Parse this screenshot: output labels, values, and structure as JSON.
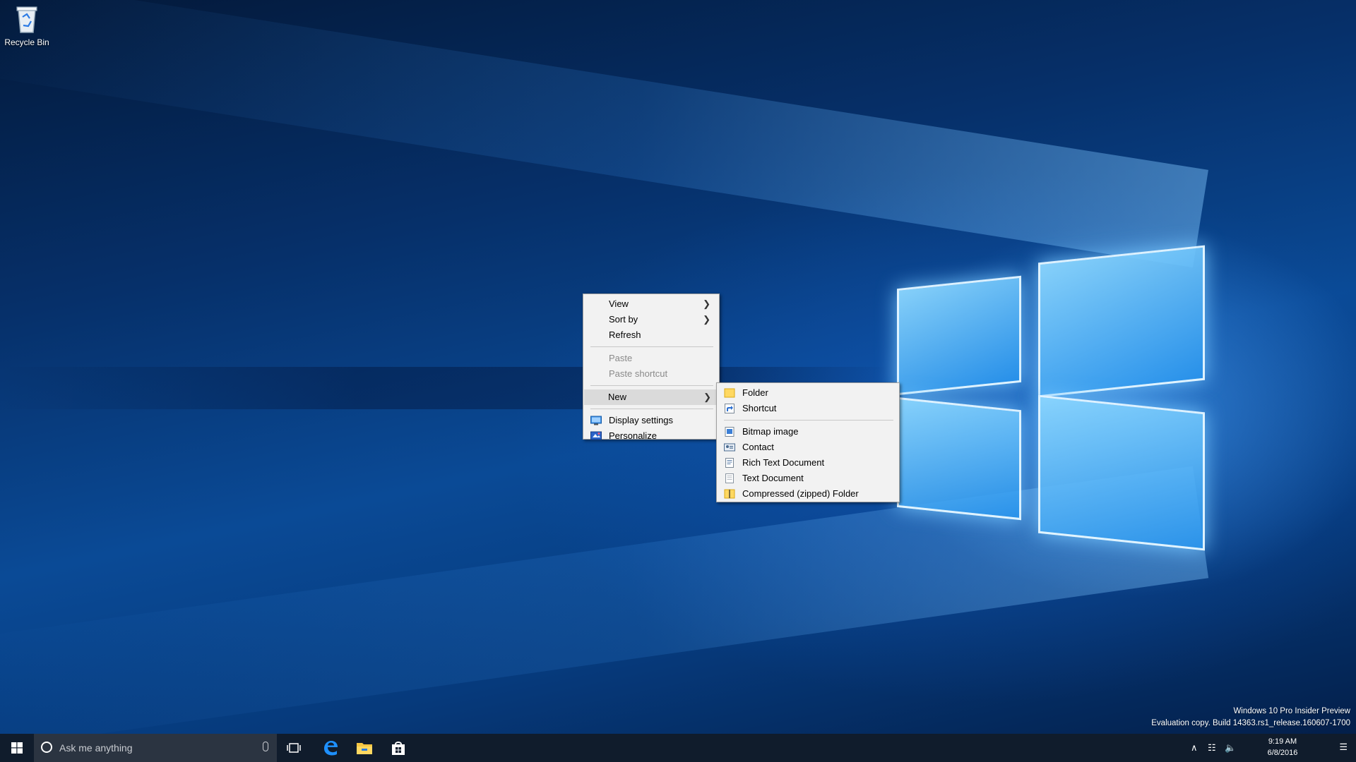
{
  "desktop": {
    "icons": [
      {
        "label": "Recycle Bin",
        "icon": "recycle-bin-icon"
      }
    ]
  },
  "context_menu": {
    "items": [
      {
        "label": "View",
        "has_submenu": true
      },
      {
        "label": "Sort by",
        "has_submenu": true
      },
      {
        "label": "Refresh"
      },
      {
        "label": "Paste",
        "disabled": true
      },
      {
        "label": "Paste shortcut",
        "disabled": true
      },
      {
        "label": "New",
        "has_submenu": true,
        "highlighted": true
      },
      {
        "label": "Display settings",
        "icon": "display-settings-icon"
      },
      {
        "label": "Personalize",
        "icon": "personalize-icon"
      }
    ]
  },
  "new_submenu": {
    "items": [
      {
        "label": "Folder",
        "icon": "folder-icon"
      },
      {
        "label": "Shortcut",
        "icon": "shortcut-icon"
      },
      {
        "label": "Bitmap image",
        "icon": "bitmap-image-icon"
      },
      {
        "label": "Contact",
        "icon": "contact-icon"
      },
      {
        "label": "Rich Text Document",
        "icon": "rich-text-document-icon"
      },
      {
        "label": "Text Document",
        "icon": "text-document-icon"
      },
      {
        "label": "Compressed (zipped) Folder",
        "icon": "zipped-folder-icon"
      }
    ]
  },
  "taskbar": {
    "search_placeholder": "Ask me anything",
    "pinned": [
      "edge-icon",
      "file-explorer-icon",
      "store-icon"
    ],
    "clock_time": "9:19 AM",
    "clock_date": "6/8/2016"
  },
  "watermark": {
    "line1": "Windows 10 Pro Insider Preview",
    "line2": "Evaluation copy. Build 14363.rs1_release.160607-1700"
  },
  "colors": {
    "accent": "#0a4a96",
    "taskbar": "#101c2c",
    "menu_bg": "#f2f2f2",
    "menu_hover": "#dadada"
  }
}
